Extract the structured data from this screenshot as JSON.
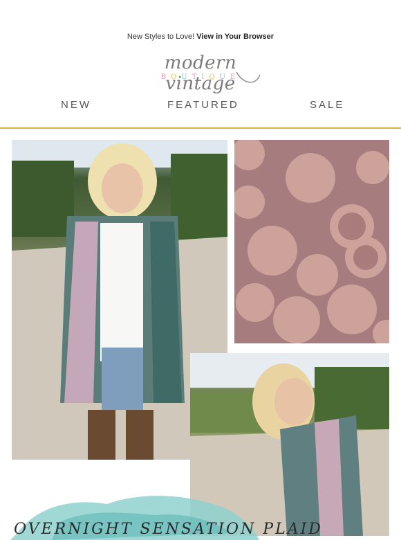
{
  "preheader": {
    "text": "New Styles to Love! ",
    "link": "View in Your Browser"
  },
  "logo": {
    "script": "modern vintage",
    "sub": [
      "B",
      "O",
      "U",
      "T",
      "I",
      "Q",
      "U",
      "E"
    ],
    "sub_colors": [
      "#e38fb4",
      "#f0c24b",
      "#7ec1cc",
      "#e38fb4",
      "#9ccf7c",
      "#f0c24b",
      "#7ec1cc",
      "#e38fb4"
    ]
  },
  "nav": {
    "items": [
      "NEW",
      "FEATURED",
      "SALE"
    ]
  },
  "colors": {
    "divider": "#d8b43c",
    "swatch": "#a77c7e",
    "splash": "#8fd1cf"
  },
  "hero": {
    "headline": "OVERNIGHT SENSATION PLAID"
  }
}
